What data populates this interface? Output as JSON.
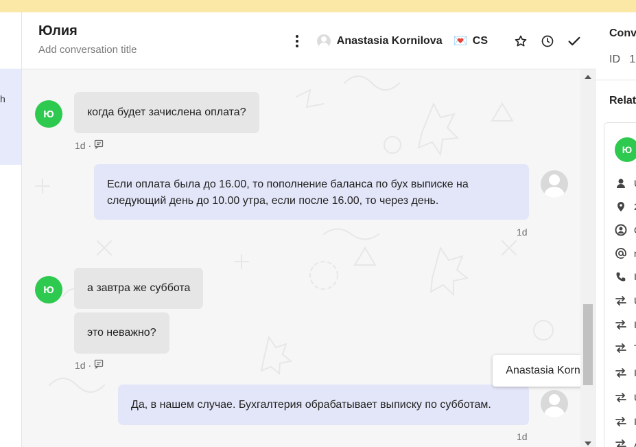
{
  "header": {
    "contact_name": "Юлия",
    "title_placeholder": "Add conversation title",
    "assignee_name": "Anastasia Kornilova",
    "team_icon": "💌",
    "team_name": "CS"
  },
  "left_sidebar": {
    "partial_text": "h"
  },
  "messages": [
    {
      "id": "m1",
      "direction": "incoming",
      "avatar_initial": "Ю",
      "text": "когда будет зачислена оплата?",
      "time": "1d ·"
    },
    {
      "id": "m2",
      "direction": "outgoing",
      "text_line1": "Если оплата была до 16.00, то пополнение баланса по бух выписке на",
      "text_line2": "следующий день до 10.00 утра, если после 16.00, то через день.",
      "time": "1d"
    },
    {
      "id": "m3",
      "direction": "incoming",
      "avatar_initial": "Ю",
      "text": "а завтра же суббота"
    },
    {
      "id": "m4",
      "direction": "incoming",
      "text": "это неважно?",
      "time": "1d ·"
    },
    {
      "id": "m5",
      "direction": "outgoing",
      "text": "Да, в нашем случае. Бухгалтерия обрабатывает выписку по субботам.",
      "time": "1d"
    }
  ],
  "tooltip": {
    "text": "Anastasia Kornilova"
  },
  "right_panel": {
    "title_partial": "Conv",
    "id_label": "ID",
    "id_value_partial": "1",
    "related_partial": "Relat",
    "contact_initial": "Ю",
    "rows": [
      {
        "icon": "person-icon",
        "text": "U"
      },
      {
        "icon": "location-pin-icon",
        "text": "2"
      },
      {
        "icon": "user-circle-icon",
        "text": "C"
      },
      {
        "icon": "at-sign-icon",
        "text": "n"
      },
      {
        "icon": "phone-icon",
        "text": "I"
      },
      {
        "icon": "swap-arrows-icon",
        "text": "U"
      },
      {
        "icon": "swap-arrows-icon",
        "text": "I"
      },
      {
        "icon": "swap-arrows-icon",
        "text": "T"
      },
      {
        "icon": "swap-arrows-icon",
        "text": "I"
      },
      {
        "icon": "swap-arrows-icon",
        "text": "U"
      },
      {
        "icon": "swap-arrows-icon",
        "text": "I"
      },
      {
        "icon": "swap-arrows-icon",
        "text": "A"
      }
    ]
  },
  "colors": {
    "banner": "#fbe8a6",
    "contact_avatar": "#2ec94f",
    "incoming_bubble": "#e6e6e6",
    "outgoing_bubble": "#e3e6f8",
    "chat_background": "#f6f6f6"
  }
}
